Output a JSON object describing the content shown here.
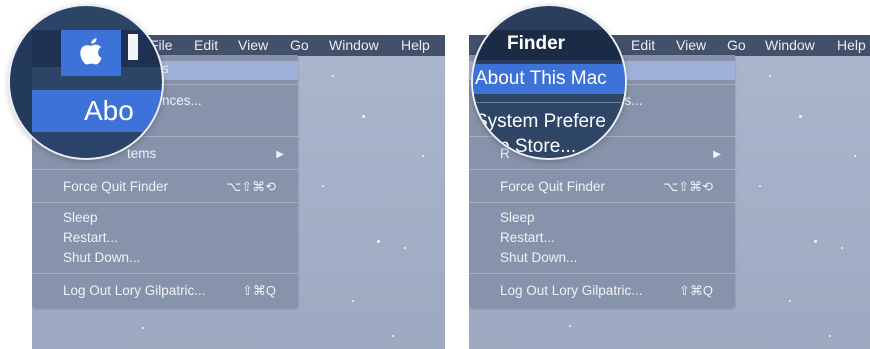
{
  "left": {
    "menubar": [
      "File",
      "Edit",
      "View",
      "Go",
      "Window",
      "Help"
    ],
    "menu": {
      "row1_partial": "s",
      "row2_partial": "nces...",
      "row3_partial": "tems",
      "force_quit": "Force Quit Finder",
      "force_quit_shortcut": "⌥⇧⌘⟲",
      "sleep": "Sleep",
      "restart": "Restart...",
      "shutdown": "Shut Down...",
      "logout": "Log Out Lory  Gilpatric...",
      "logout_shortcut": "⇧⌘Q"
    },
    "magnifier": {
      "apple_glyph": "",
      "about_partial": "Abo"
    }
  },
  "right": {
    "menubar": [
      "Fi",
      "Edit",
      "View",
      "Go",
      "Window",
      "Help"
    ],
    "menu": {
      "row2_partial": "es...",
      "row3_partial": "R",
      "force_quit": "Force Quit Finder",
      "force_quit_shortcut": "⌥⇧⌘⟲",
      "sleep": "Sleep",
      "restart": "Restart...",
      "shutdown": "Shut Down...",
      "logout": "Log Out Lory  Gilpatric...",
      "logout_shortcut": "⇧⌘Q"
    },
    "magnifier": {
      "app_name": "Finder",
      "about": "About This Mac",
      "system_prefs": "System Prefere",
      "app_store": "p Store..."
    }
  },
  "colors": {
    "menubar": "#43506a",
    "menu": "#8793ab",
    "highlight": "#a0b1d9",
    "selected": "#3d73d9",
    "desktop": "#a6b3c9"
  }
}
